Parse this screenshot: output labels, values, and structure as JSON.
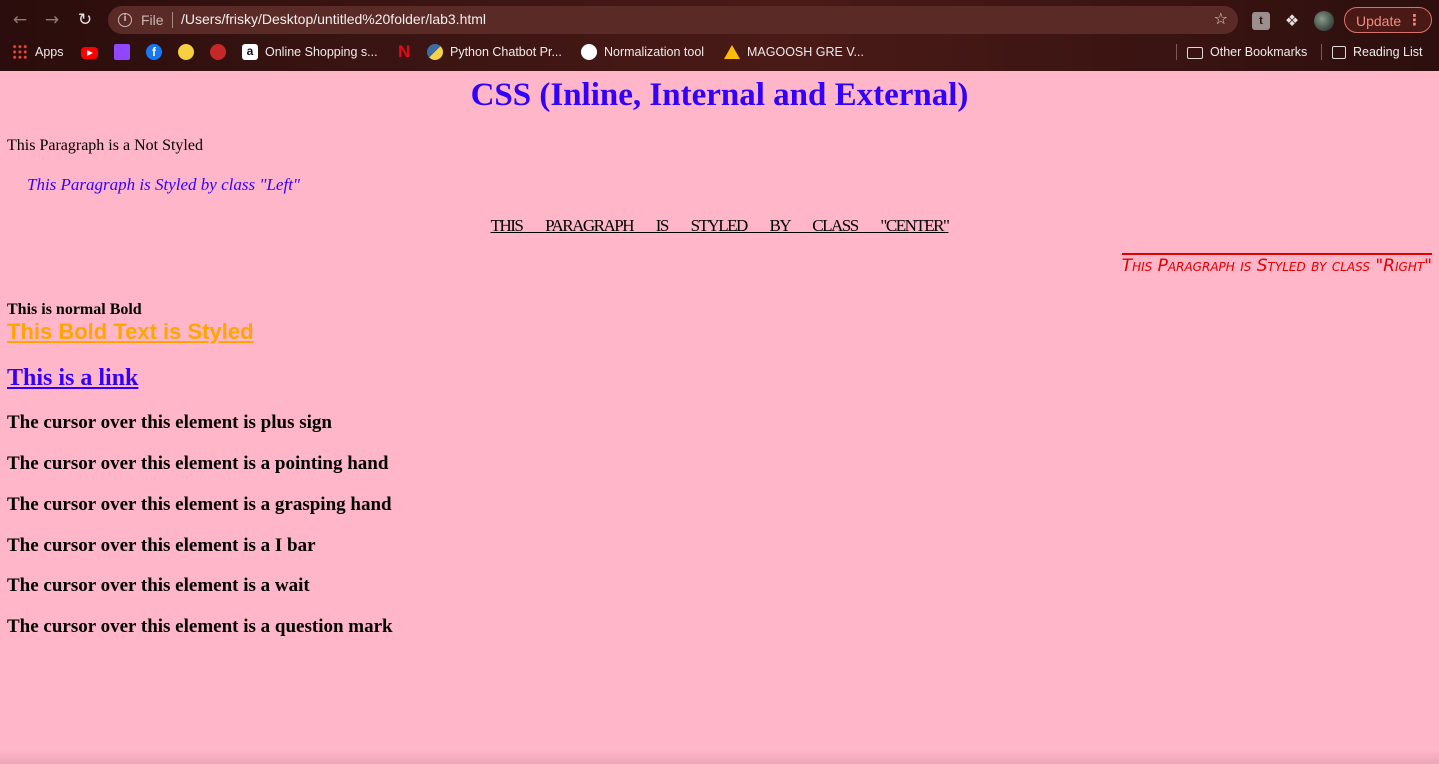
{
  "browser": {
    "url": "/Users/frisky/Desktop/untitled%20folder/lab3.html",
    "scheme_label": "File",
    "update_label": "Update",
    "ext_letter": "t",
    "bookmarks": [
      {
        "label": "Apps"
      },
      {
        "label": ""
      },
      {
        "label": ""
      },
      {
        "label": ""
      },
      {
        "label": ""
      },
      {
        "label": ""
      },
      {
        "label": "Online Shopping s..."
      },
      {
        "label": ""
      },
      {
        "label": "Python Chatbot Pr..."
      },
      {
        "label": "Normalization tool"
      },
      {
        "label": "MAGOOSH GRE V..."
      }
    ],
    "other_bookmarks": "Other Bookmarks",
    "reading_list": "Reading List",
    "accent": "#f28b82"
  },
  "page": {
    "background": "#ffb6c8",
    "heading": "CSS (Inline, Internal and External)",
    "p_plain": "This Paragraph is a Not Styled",
    "p_left": "This Paragraph is Styled by class \"Left\"",
    "p_center": "This Paragraph is Styled by class \"Center\"",
    "p_right": "This Paragraph is Styled by class \"Right\"",
    "bold_normal": "This is normal Bold",
    "bold_styled": "This Bold Text is Styled",
    "link": "This is a link",
    "cursor_lines": [
      "The cursor over this element is plus sign",
      "The cursor over this element is a pointing hand",
      "The cursor over this element is a grasping hand",
      "The cursor over this element is a I bar",
      "The cursor over this element is a wait",
      "The cursor over this element is a question mark"
    ],
    "colors": {
      "heading": "#3300ff",
      "left": "#3300ff",
      "right": "#e00000",
      "bold_styled": "#ffa500",
      "link": "#3300ff"
    }
  }
}
